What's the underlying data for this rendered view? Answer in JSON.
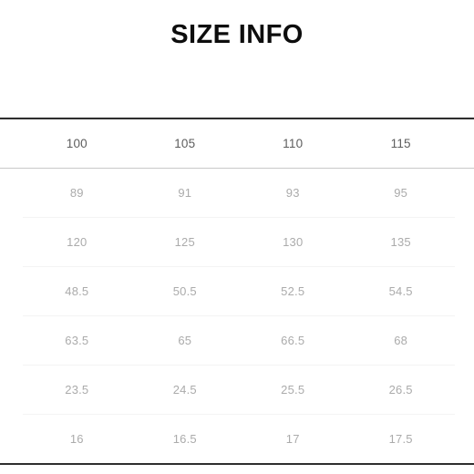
{
  "page": {
    "title": "SIZE INFO",
    "background_color": "#ffffff",
    "title_color": "#0d0d0d",
    "header_text_color": "#5d5d5d",
    "cell_text_color": "#ababab",
    "rule_color": "#2e2e2e",
    "header_divider_color": "#c9c9c9",
    "row_divider_color": "#f4f4f4"
  },
  "table": {
    "row_label_header": "",
    "columns": [
      "100",
      "105",
      "110",
      "115"
    ],
    "rows": [
      {
        "label": "",
        "values": [
          "89",
          "91",
          "93",
          "95"
        ]
      },
      {
        "label": "",
        "values": [
          "120",
          "125",
          "130",
          "135"
        ]
      },
      {
        "label": "",
        "values": [
          "48.5",
          "50.5",
          "52.5",
          "54.5"
        ]
      },
      {
        "label": "",
        "values": [
          "63.5",
          "65",
          "66.5",
          "68"
        ]
      },
      {
        "label": "",
        "values": [
          "23.5",
          "24.5",
          "25.5",
          "26.5"
        ]
      },
      {
        "label": "",
        "values": [
          "16",
          "16.5",
          "17",
          "17.5"
        ]
      }
    ]
  },
  "chart_data": {
    "type": "table",
    "title": "SIZE INFO",
    "categories": [
      "100",
      "105",
      "110",
      "115"
    ],
    "series": [
      {
        "name": "row-1",
        "values": [
          89,
          91,
          93,
          95
        ]
      },
      {
        "name": "row-2",
        "values": [
          120,
          125,
          130,
          135
        ]
      },
      {
        "name": "row-3",
        "values": [
          48.5,
          50.5,
          52.5,
          54.5
        ]
      },
      {
        "name": "row-4",
        "values": [
          63.5,
          65,
          66.5,
          68
        ]
      },
      {
        "name": "row-5",
        "values": [
          23.5,
          24.5,
          25.5,
          26.5
        ]
      },
      {
        "name": "row-6",
        "values": [
          16,
          16.5,
          17,
          17.5
        ]
      }
    ],
    "xlabel": "",
    "ylabel": "",
    "grid": true,
    "legend": "none"
  }
}
